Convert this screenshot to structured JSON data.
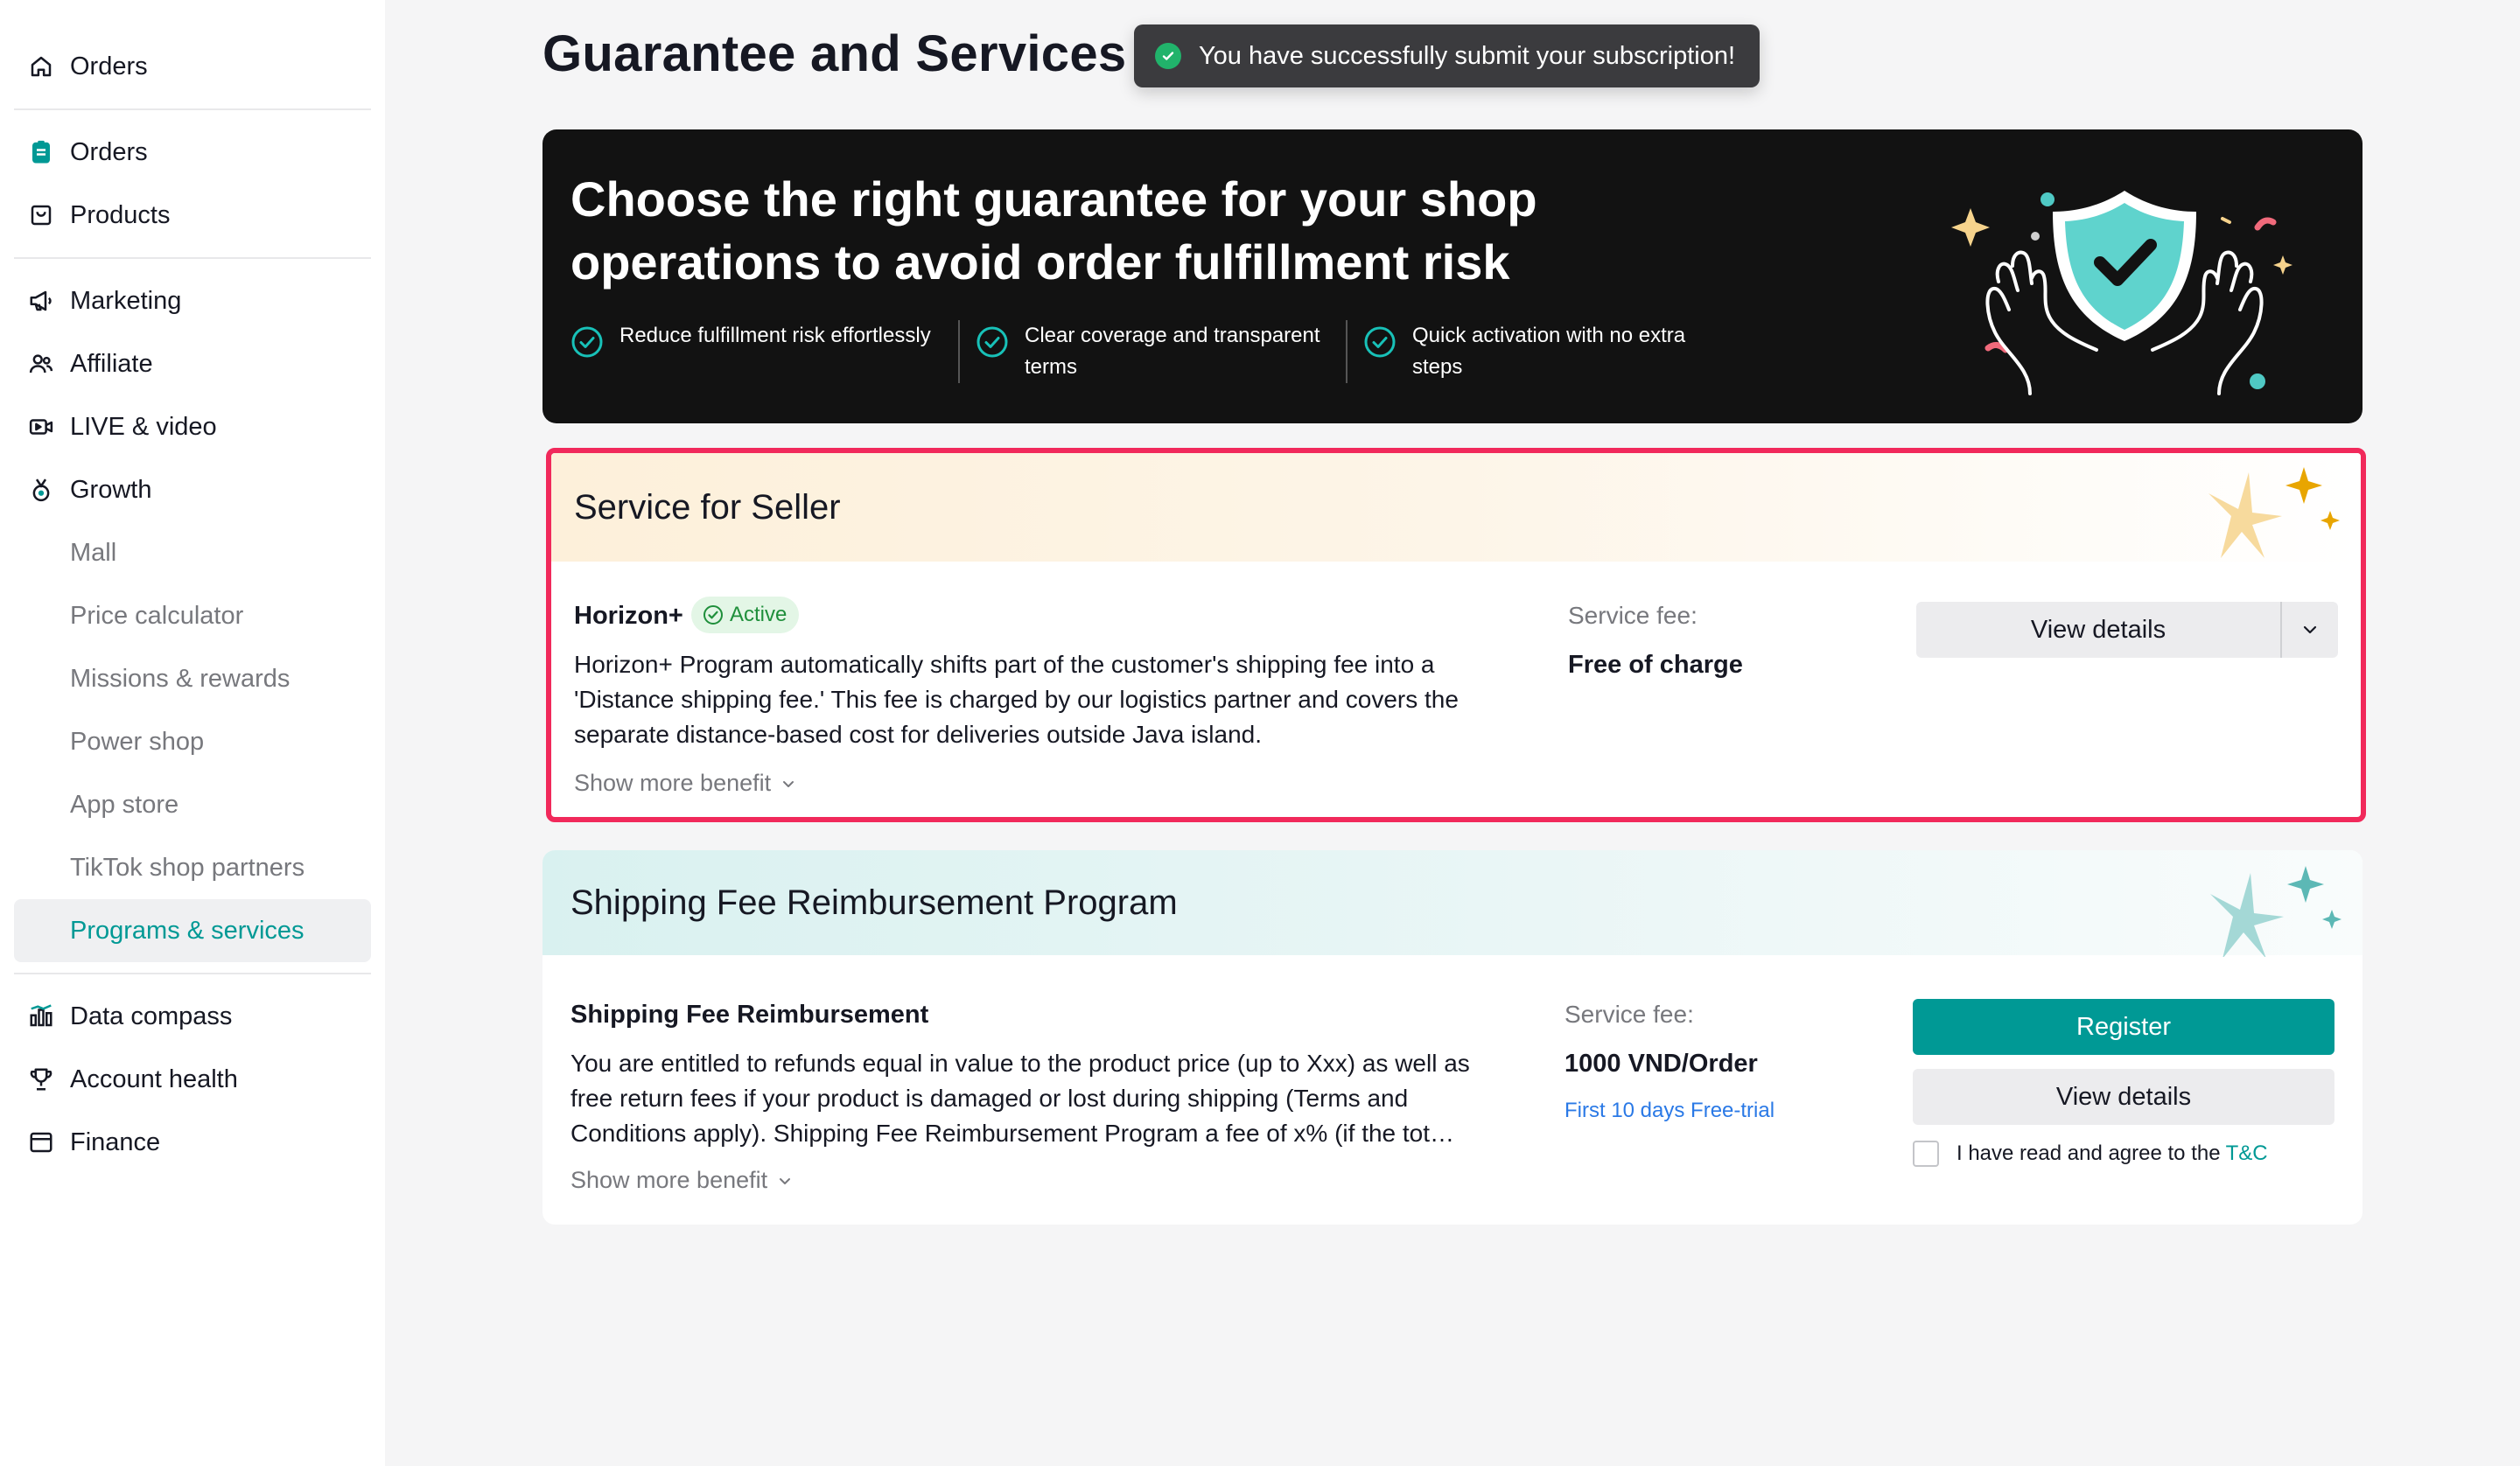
{
  "sidebar": {
    "top_item": {
      "label": "Orders",
      "icon": "home-icon"
    },
    "items_group1": [
      {
        "label": "Orders",
        "icon": "clipboard-icon"
      },
      {
        "label": "Products",
        "icon": "bag-icon"
      }
    ],
    "items_group2": [
      {
        "label": "Marketing",
        "icon": "megaphone-icon"
      },
      {
        "label": "Affiliate",
        "icon": "people-icon"
      },
      {
        "label": "LIVE & video",
        "icon": "video-icon"
      },
      {
        "label": "Growth",
        "icon": "medal-icon"
      }
    ],
    "growth_sub": [
      "Mall",
      "Price calculator",
      "Missions & rewards",
      "Power shop",
      "App store",
      "TikTok shop partners",
      "Programs & services"
    ],
    "items_group3": [
      {
        "label": "Data compass",
        "icon": "bar-chart-icon"
      },
      {
        "label": "Account health",
        "icon": "trophy-icon"
      },
      {
        "label": "Finance",
        "icon": "wallet-icon"
      }
    ],
    "active_item": "Programs & services",
    "accent_color": "#009995"
  },
  "page": {
    "title": "Guarantee and Services"
  },
  "toast": {
    "message": "You have successfully submit your subscription!",
    "status_color": "#21b36b"
  },
  "banner": {
    "title": "Choose the right guarantee for your shop operations to avoid order fulfillment risk",
    "points": [
      "Reduce fulfillment risk effortlessly",
      "Clear coverage and transparent terms",
      "Quick activation with no extra steps"
    ],
    "art_icon": "shield-check-hands-icon"
  },
  "card_seller": {
    "title": "Service for Seller",
    "service_name": "Horizon+",
    "status": "Active",
    "description": "Horizon+ Program automatically shifts part of the customer's shipping fee into a 'Distance shipping fee.' This fee is charged by our logistics partner and covers the separate distance-based cost for deliveries outside Java island.",
    "show_more": "Show more benefit",
    "fee_label": "Service fee:",
    "fee_value": "Free of charge",
    "view_details": "View details",
    "highlight_color": "#f1295b"
  },
  "card_shipping": {
    "title": "Shipping Fee Reimbursement Program",
    "service_name": "Shipping Fee Reimbursement",
    "description": "You are entitled to refunds equal in value to the product price (up to Xxx) as well as free return fees if your product is damaged or lost during shipping (Terms and Conditions apply). Shipping Fee Reimbursement Program a fee of x% (if the tot…",
    "show_more": "Show more benefit",
    "fee_label": "Service fee:",
    "fee_value": "1000 VND/Order",
    "trial": "First 10 days Free-trial",
    "register": "Register",
    "view_details": "View details",
    "agree_text": "I have read and agree to the",
    "agree_link": "T&C"
  }
}
